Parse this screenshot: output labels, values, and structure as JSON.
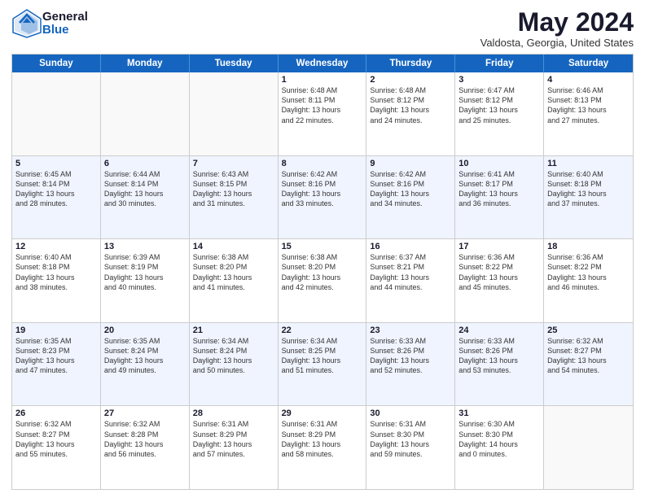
{
  "header": {
    "logo_general": "General",
    "logo_blue": "Blue",
    "main_title": "May 2024",
    "subtitle": "Valdosta, Georgia, United States"
  },
  "days_of_week": [
    "Sunday",
    "Monday",
    "Tuesday",
    "Wednesday",
    "Thursday",
    "Friday",
    "Saturday"
  ],
  "weeks": [
    [
      {
        "day": "",
        "info": ""
      },
      {
        "day": "",
        "info": ""
      },
      {
        "day": "",
        "info": ""
      },
      {
        "day": "1",
        "info": "Sunrise: 6:48 AM\nSunset: 8:11 PM\nDaylight: 13 hours\nand 22 minutes."
      },
      {
        "day": "2",
        "info": "Sunrise: 6:48 AM\nSunset: 8:12 PM\nDaylight: 13 hours\nand 24 minutes."
      },
      {
        "day": "3",
        "info": "Sunrise: 6:47 AM\nSunset: 8:12 PM\nDaylight: 13 hours\nand 25 minutes."
      },
      {
        "day": "4",
        "info": "Sunrise: 6:46 AM\nSunset: 8:13 PM\nDaylight: 13 hours\nand 27 minutes."
      }
    ],
    [
      {
        "day": "5",
        "info": "Sunrise: 6:45 AM\nSunset: 8:14 PM\nDaylight: 13 hours\nand 28 minutes."
      },
      {
        "day": "6",
        "info": "Sunrise: 6:44 AM\nSunset: 8:14 PM\nDaylight: 13 hours\nand 30 minutes."
      },
      {
        "day": "7",
        "info": "Sunrise: 6:43 AM\nSunset: 8:15 PM\nDaylight: 13 hours\nand 31 minutes."
      },
      {
        "day": "8",
        "info": "Sunrise: 6:42 AM\nSunset: 8:16 PM\nDaylight: 13 hours\nand 33 minutes."
      },
      {
        "day": "9",
        "info": "Sunrise: 6:42 AM\nSunset: 8:16 PM\nDaylight: 13 hours\nand 34 minutes."
      },
      {
        "day": "10",
        "info": "Sunrise: 6:41 AM\nSunset: 8:17 PM\nDaylight: 13 hours\nand 36 minutes."
      },
      {
        "day": "11",
        "info": "Sunrise: 6:40 AM\nSunset: 8:18 PM\nDaylight: 13 hours\nand 37 minutes."
      }
    ],
    [
      {
        "day": "12",
        "info": "Sunrise: 6:40 AM\nSunset: 8:18 PM\nDaylight: 13 hours\nand 38 minutes."
      },
      {
        "day": "13",
        "info": "Sunrise: 6:39 AM\nSunset: 8:19 PM\nDaylight: 13 hours\nand 40 minutes."
      },
      {
        "day": "14",
        "info": "Sunrise: 6:38 AM\nSunset: 8:20 PM\nDaylight: 13 hours\nand 41 minutes."
      },
      {
        "day": "15",
        "info": "Sunrise: 6:38 AM\nSunset: 8:20 PM\nDaylight: 13 hours\nand 42 minutes."
      },
      {
        "day": "16",
        "info": "Sunrise: 6:37 AM\nSunset: 8:21 PM\nDaylight: 13 hours\nand 44 minutes."
      },
      {
        "day": "17",
        "info": "Sunrise: 6:36 AM\nSunset: 8:22 PM\nDaylight: 13 hours\nand 45 minutes."
      },
      {
        "day": "18",
        "info": "Sunrise: 6:36 AM\nSunset: 8:22 PM\nDaylight: 13 hours\nand 46 minutes."
      }
    ],
    [
      {
        "day": "19",
        "info": "Sunrise: 6:35 AM\nSunset: 8:23 PM\nDaylight: 13 hours\nand 47 minutes."
      },
      {
        "day": "20",
        "info": "Sunrise: 6:35 AM\nSunset: 8:24 PM\nDaylight: 13 hours\nand 49 minutes."
      },
      {
        "day": "21",
        "info": "Sunrise: 6:34 AM\nSunset: 8:24 PM\nDaylight: 13 hours\nand 50 minutes."
      },
      {
        "day": "22",
        "info": "Sunrise: 6:34 AM\nSunset: 8:25 PM\nDaylight: 13 hours\nand 51 minutes."
      },
      {
        "day": "23",
        "info": "Sunrise: 6:33 AM\nSunset: 8:26 PM\nDaylight: 13 hours\nand 52 minutes."
      },
      {
        "day": "24",
        "info": "Sunrise: 6:33 AM\nSunset: 8:26 PM\nDaylight: 13 hours\nand 53 minutes."
      },
      {
        "day": "25",
        "info": "Sunrise: 6:32 AM\nSunset: 8:27 PM\nDaylight: 13 hours\nand 54 minutes."
      }
    ],
    [
      {
        "day": "26",
        "info": "Sunrise: 6:32 AM\nSunset: 8:27 PM\nDaylight: 13 hours\nand 55 minutes."
      },
      {
        "day": "27",
        "info": "Sunrise: 6:32 AM\nSunset: 8:28 PM\nDaylight: 13 hours\nand 56 minutes."
      },
      {
        "day": "28",
        "info": "Sunrise: 6:31 AM\nSunset: 8:29 PM\nDaylight: 13 hours\nand 57 minutes."
      },
      {
        "day": "29",
        "info": "Sunrise: 6:31 AM\nSunset: 8:29 PM\nDaylight: 13 hours\nand 58 minutes."
      },
      {
        "day": "30",
        "info": "Sunrise: 6:31 AM\nSunset: 8:30 PM\nDaylight: 13 hours\nand 59 minutes."
      },
      {
        "day": "31",
        "info": "Sunrise: 6:30 AM\nSunset: 8:30 PM\nDaylight: 14 hours\nand 0 minutes."
      },
      {
        "day": "",
        "info": ""
      }
    ]
  ]
}
